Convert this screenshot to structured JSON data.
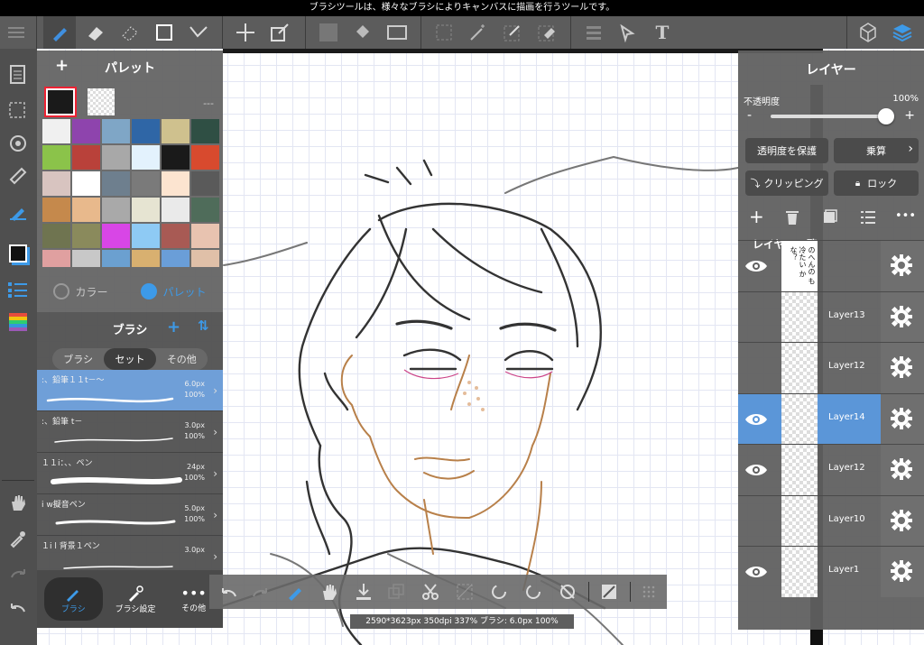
{
  "tooltip": "ブラシツールは、様々なブラシによりキャンバスに描画を行うツールです。",
  "toolbar": {
    "icons": [
      "menu-icon",
      "brush-tool-icon",
      "eraser-icon",
      "blur-eraser-icon",
      "rectangle-shape-icon",
      "curve-icon",
      "move-icon",
      "transform-icon",
      "fill-color-icon",
      "bucket-icon",
      "gradation-icon",
      "select-rect-icon",
      "magic-wand-icon",
      "select-pen-icon",
      "select-eraser-icon",
      "filter-icon",
      "operation-icon",
      "text-icon",
      "material-icon",
      "layers-icon"
    ]
  },
  "palette": {
    "title": "パレット",
    "add_label": "+",
    "more_label": "---",
    "main_color": "#1a1a1a",
    "swatches": [
      "#f0f0f0",
      "#8e44ad",
      "#7fa6c6",
      "#2f66a6",
      "#cfc18e",
      "#2f4f44",
      "#8bc34a",
      "#b9413a",
      "#a8a8a8",
      "#e3f2fd",
      "#1a1a1a",
      "#d84a2e",
      "#d8c4c0",
      "#ffffff",
      "#6e7f8e",
      "#7a7a7a",
      "#fce4d0",
      "#5a5a5a",
      "#c5894c",
      "#e8b98c",
      "#a9a9a9",
      "#e6e4d2",
      "#eaeaea",
      "#4f6c5a",
      "#6f7450",
      "#8a8a5c",
      "#d846e6",
      "#8ecaf4",
      "#a85a54",
      "#e8c3b0",
      "#e0a0a0",
      "#c8c8c8",
      "#6ba0d0",
      "#d8b070",
      "#6a9ed8",
      "#e0c0a8"
    ],
    "tab_color": "カラー",
    "tab_palette": "パレット"
  },
  "brush": {
    "title": "ブラシ",
    "tabs": [
      "ブラシ",
      "セット",
      "その他"
    ],
    "active_tab": "セット",
    "items": [
      {
        "name": ":、鉛筆１１t－～",
        "size": "6.0px",
        "opacity": "100%"
      },
      {
        "name": ":、鉛筆 t－",
        "size": "3.0px",
        "opacity": "100%"
      },
      {
        "name": "１１i：、、ペン",
        "size": "24px",
        "opacity": "100%"
      },
      {
        "name": "i w擬音ペン",
        "size": "5.0px",
        "opacity": "100%"
      },
      {
        "name": "１i l 背景１ペン",
        "size": "3.0px",
        "opacity": ""
      }
    ],
    "bottom": [
      "ブラシ",
      "ブラシ設定",
      "その他"
    ]
  },
  "status": "2590*3623px 350dpi 337% ブラシ: 6.0px 100%",
  "layer": {
    "title": "レイヤー",
    "opacity_label": "不透明度",
    "opacity_value": "100%",
    "opacity_level": 1.0,
    "minus": "-",
    "plus": "+",
    "protect_label": "透明度を保護",
    "blend_label": "乗算",
    "clipping_label": "クリッピング",
    "lock_label": "ロック",
    "list_label": "レイヤー一覧",
    "text_layer_preview": "のへんの も冷たい かな？",
    "layers": [
      {
        "name": "",
        "visible": true,
        "selected": false
      },
      {
        "name": "Layer13",
        "visible": false,
        "selected": false
      },
      {
        "name": "Layer12",
        "visible": false,
        "selected": false
      },
      {
        "name": "Layer14",
        "visible": true,
        "selected": true
      },
      {
        "name": "Layer12",
        "visible": true,
        "selected": false
      },
      {
        "name": "Layer10",
        "visible": false,
        "selected": false
      },
      {
        "name": "Layer1",
        "visible": true,
        "selected": false
      }
    ]
  }
}
